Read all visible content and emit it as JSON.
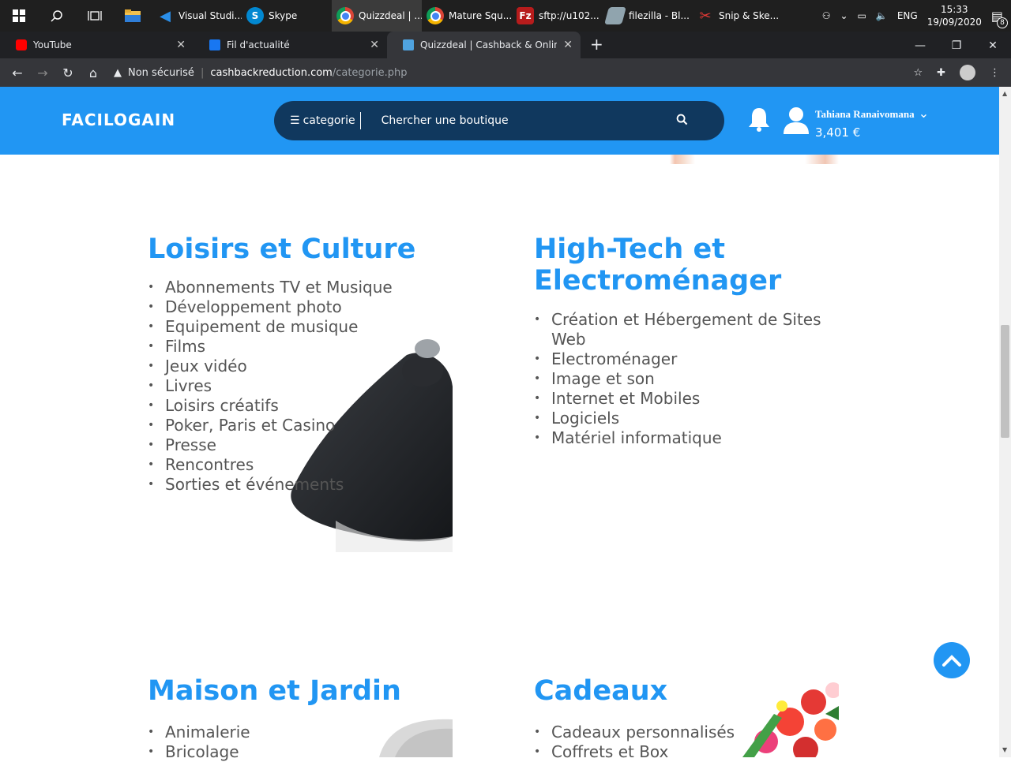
{
  "taskbar": {
    "apps": [
      {
        "label": "Visual Studi...",
        "icon": "vscode-icon",
        "color": "#1e88e5"
      },
      {
        "label": "Skype",
        "icon": "skype-icon",
        "color": "#0288d1"
      },
      {
        "label": "Quizzdeal | ...",
        "icon": "chrome-icon",
        "color": "#4caf50"
      },
      {
        "label": "Mature Squ...",
        "icon": "chrome-icon",
        "color": "#4caf50"
      },
      {
        "label": "sftp://u102...",
        "icon": "filezilla-icon",
        "color": "#c62828"
      },
      {
        "label": "filezilla - Bl...",
        "icon": "notes-icon",
        "color": "#90a4ae"
      },
      {
        "label": "Snip & Ske...",
        "icon": "scissors-icon",
        "color": "#e53935"
      }
    ],
    "tray": {
      "language": "ENG",
      "time": "15:33",
      "date": "19/09/2020",
      "notifications": "8"
    }
  },
  "browser": {
    "tabs": [
      {
        "title": "YouTube",
        "favicon": "youtube-icon",
        "color": "#ff0000"
      },
      {
        "title": "Fil d'actualité",
        "favicon": "facebook-icon",
        "color": "#1877f2"
      },
      {
        "title": "Quizzdeal | Cashback & Online Sh",
        "favicon": "site-icon",
        "color": "#4fa3e0"
      }
    ],
    "security": "Non sécurisé",
    "url_host": "cashbackreduction.com",
    "url_path": "/categorie.php"
  },
  "site": {
    "logo": "FACILOGAIN",
    "category_button": "categorie",
    "search_placeholder": "Chercher une boutique",
    "user_name": "Tahiana Ranaivomana",
    "balance": "3,401 €",
    "accent": "#2196f3",
    "search_bg": "#10385e"
  },
  "sections": [
    {
      "title": "Loisirs et Culture",
      "items": [
        "Abonnements TV et Musique",
        "Développement photo",
        "Equipement de musique",
        "Films",
        "Jeux vidéo",
        "Livres",
        "Loisirs créatifs",
        "Poker, Paris et Casino",
        "Presse",
        "Rencontres",
        "Sorties et événements"
      ]
    },
    {
      "title_line1": "High-Tech et",
      "title_line2": "Electroménager",
      "items": [
        "Création et Hébergement de Sites Web",
        "Electroménager",
        "Image et son",
        "Internet et Mobiles",
        "Logiciels",
        "Matériel informatique"
      ]
    },
    {
      "title": "Maison et Jardin",
      "items": [
        "Animalerie",
        "Bricolage"
      ]
    },
    {
      "title": "Cadeaux",
      "items": [
        "Cadeaux personnalisés",
        "Coffrets et Box"
      ]
    }
  ]
}
